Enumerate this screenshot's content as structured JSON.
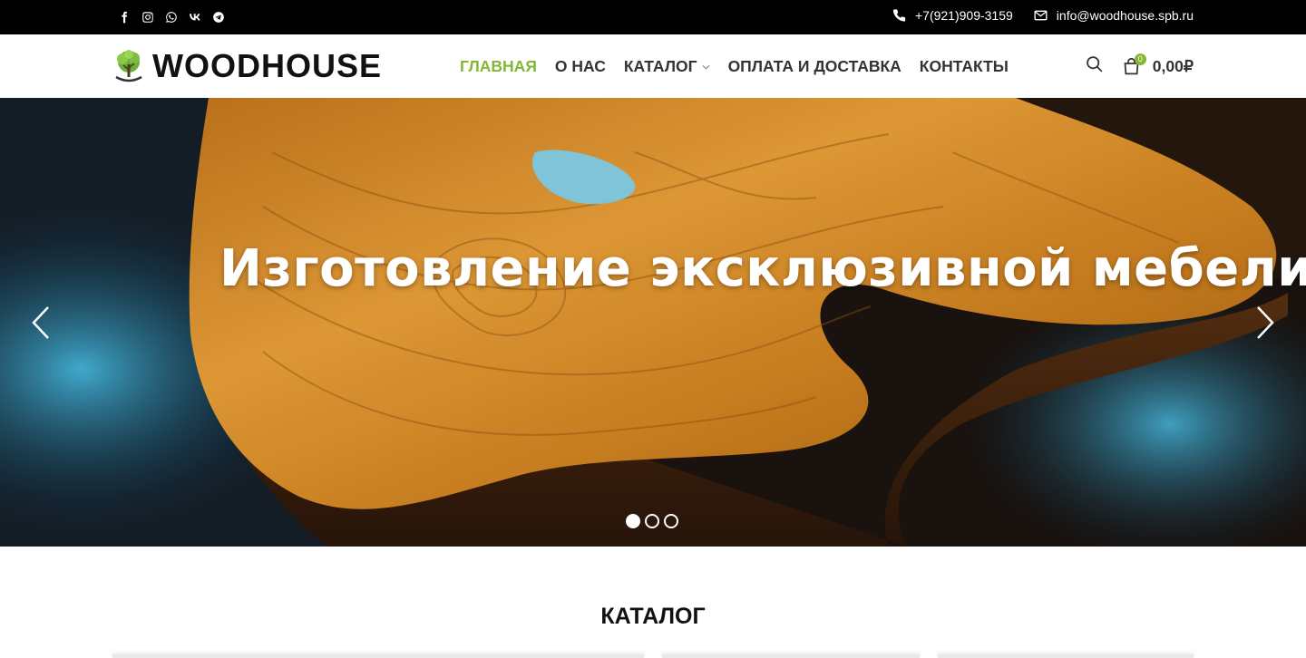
{
  "topbar": {
    "social": [
      {
        "icon": "facebook-icon"
      },
      {
        "icon": "instagram-icon"
      },
      {
        "icon": "whatsapp-icon"
      },
      {
        "icon": "vk-icon"
      },
      {
        "icon": "telegram-icon"
      }
    ],
    "phone": "+7(921)909-3159",
    "email": "info@woodhouse.spb.ru"
  },
  "header": {
    "logo_text": "WOODHOUSE",
    "nav": [
      {
        "label": "ГЛАВНАЯ",
        "active": true
      },
      {
        "label": "О НАС",
        "active": false
      },
      {
        "label": "КАТАЛОГ",
        "active": false,
        "has_dropdown": true
      },
      {
        "label": "ОПЛАТА И ДОСТАВКА",
        "active": false
      },
      {
        "label": "КОНТАКТЫ",
        "active": false
      }
    ],
    "cart_count": "0",
    "cart_total": "0,00₽"
  },
  "hero": {
    "title": "Изготовление эксклюзивной мебели",
    "slides_total": 3,
    "active_slide": 1
  },
  "catalog": {
    "title": "КАТАЛОГ"
  },
  "colors": {
    "accent": "#83b735",
    "topbar_bg": "#000000",
    "text": "#333333"
  }
}
